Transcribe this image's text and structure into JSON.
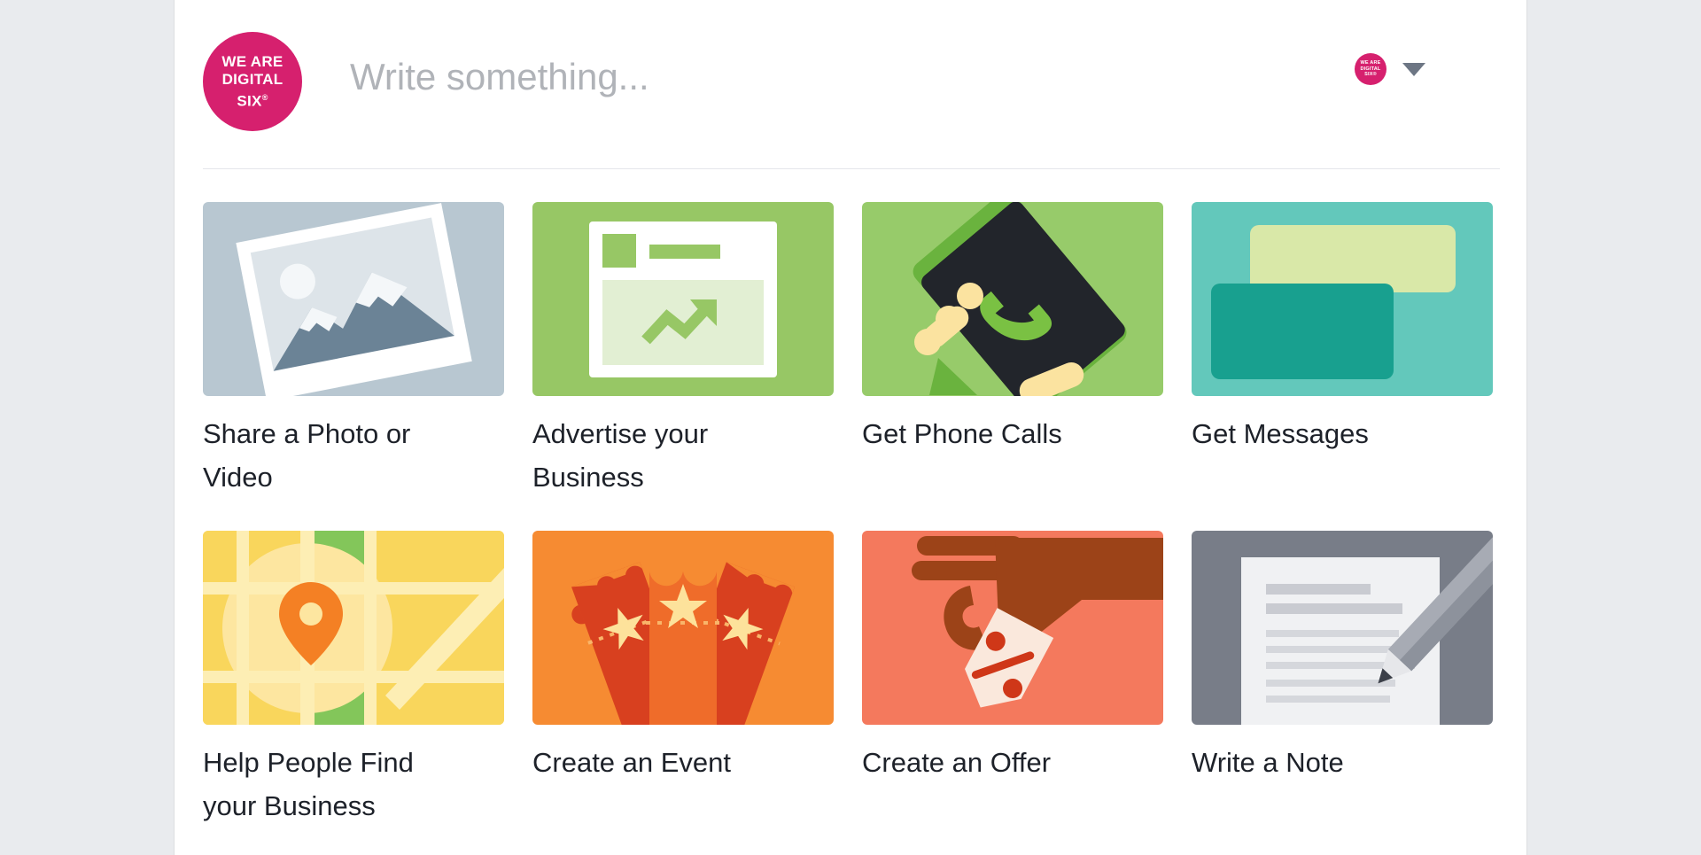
{
  "brand": {
    "accent": "#d6206e",
    "logo_line1": "WE ARE",
    "logo_line2": "DIGITAL",
    "logo_line3": "SIX",
    "logo_mark": "®"
  },
  "composer": {
    "placeholder": "Write something...",
    "value": ""
  },
  "account": {
    "avatar_line1": "WE ARE",
    "avatar_line2": "DIGITAL",
    "avatar_line3": "SIX®",
    "dropdown_icon": "chevron-down-icon"
  },
  "tiles": [
    {
      "id": "share-photo-or-video",
      "label": "Share a Photo or Video",
      "icon": "photo-icon",
      "bg": "#b8c7d1"
    },
    {
      "id": "advertise-your-business",
      "label": "Advertise your Business",
      "icon": "browser-chart-icon",
      "bg": "#97c765"
    },
    {
      "id": "get-phone-calls",
      "label": "Get Phone Calls",
      "icon": "hand-phone-icon",
      "bg": "#97cb6a"
    },
    {
      "id": "get-messages",
      "label": "Get Messages",
      "icon": "chat-bubbles-icon",
      "bg": "#63c8bb"
    },
    {
      "id": "help-people-find-your-business",
      "label": "Help People Find your Business",
      "icon": "map-pin-icon",
      "bg": "#f9d65c"
    },
    {
      "id": "create-an-event",
      "label": "Create an Event",
      "icon": "tickets-icon",
      "bg": "#f68b32"
    },
    {
      "id": "create-an-offer",
      "label": "Create an Offer",
      "icon": "price-tag-hand-icon",
      "bg": "#f4795d"
    },
    {
      "id": "write-a-note",
      "label": "Write a Note",
      "icon": "note-pencil-icon",
      "bg": "#787d88"
    }
  ]
}
